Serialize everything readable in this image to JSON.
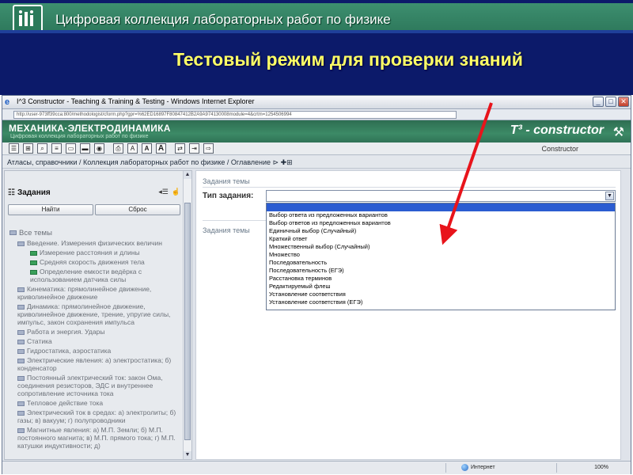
{
  "slide": {
    "header_title": "Цифровая коллекция лабораторных работ по физике",
    "title": "Тестовый режим для проверки знаний"
  },
  "browser": {
    "window_title": "I^3 Constructor - Teaching & Training & Testing - Windows Internet Explorer",
    "address": "http://user-973ff39cca:800/methodologist/cform.php?gpr=%62ED16897F80847412B2A9A974130008module=4&crtm=1254506994",
    "status_zone": "Интернет",
    "zoom": "100%"
  },
  "app": {
    "brand": "МЕХАНИКА·ЭЛЕКТРОДИНАМИКА",
    "brand_sub": "Цифровая коллекция лабораторных работ по физике",
    "constructor_logo": "T³ - constructor",
    "toolbar_label": "Constructor",
    "toolbar_icons": [
      "list-icon",
      "hierarchy-icon",
      "search-icon",
      "list-edit-icon",
      "window-icon",
      "window-tab-icon",
      "camera-icon",
      "print-icon",
      "font-small-icon",
      "font-medium-icon",
      "font-large-icon",
      "transfer-icon",
      "export-icon",
      "login-icon"
    ]
  },
  "breadcrumb": {
    "items": [
      "Атласы, справочники",
      "Коллекция лабораторных работ по физике",
      "Оглавление"
    ],
    "separator": " / "
  },
  "left_panel": {
    "title": "Задания",
    "find_button": "Найти",
    "reset_button": "Сброс",
    "tree": [
      {
        "level": 0,
        "type": "folder",
        "label": "Все темы"
      },
      {
        "level": 1,
        "type": "folder",
        "label": "Введение. Измерения физических величин"
      },
      {
        "level": 2,
        "type": "item",
        "label": "Измерение расстояния и длины"
      },
      {
        "level": 2,
        "type": "item",
        "label": "Средняя скорость движения тела"
      },
      {
        "level": 2,
        "type": "item",
        "label": "Определение емкости ведёрка с использованием датчика силы"
      },
      {
        "level": 1,
        "type": "folder",
        "label": "Кинематика: прямолинейное движение, криволинейное движение"
      },
      {
        "level": 1,
        "type": "folder",
        "label": "Динамика: прямолинейное движение, криволинейное движение, трение, упругие силы, импульс, закон сохранения импульса"
      },
      {
        "level": 1,
        "type": "folder",
        "label": "Работа и энергия. Удары"
      },
      {
        "level": 1,
        "type": "folder",
        "label": "Статика"
      },
      {
        "level": 1,
        "type": "folder",
        "label": "Гидростатика, аэростатика"
      },
      {
        "level": 1,
        "type": "folder",
        "label": "Электрические явления: а) электростатика; б) конденсатор"
      },
      {
        "level": 1,
        "type": "folder",
        "label": "Постоянный электрический ток: закон Ома, соединения резисторов, ЭДС и внутреннее сопротивление источника тока"
      },
      {
        "level": 1,
        "type": "folder",
        "label": "Тепловое действие тока"
      },
      {
        "level": 1,
        "type": "folder",
        "label": "Электрический ток в средах: а) электролиты; б) газы; в) вакуум; г) полупроводники"
      },
      {
        "level": 1,
        "type": "folder",
        "label": "Магнитные явления: а) М.П. Земли; б) М.П. постоянного магнита; в) М.П. прямого тока; г) М.П. катушки индуктивности; д)"
      }
    ]
  },
  "content": {
    "section_top": "Задания темы",
    "type_label": "Тип задания:",
    "section_mid": "Задания темы",
    "dropdown_options": [
      "Выбор ответа из предложенных вариантов",
      "Выбор ответов из предложенных вариантов",
      "Единичный выбор (Случайный)",
      "Краткий ответ",
      "Множественный выбор (Случайный)",
      "Множество",
      "Последовательность",
      "Последовательность (ЕГЭ)",
      "Расстановка терминов",
      "Редактируемый флеш",
      "Установление соответствия",
      "Установление соответствия (ЕГЭ)"
    ]
  },
  "colors": {
    "slide_bg": "#0c1a6a",
    "header_band": "#3d8f6f",
    "slide_title": "#ffff66",
    "app_banner": "#3c8a66",
    "selection": "#2b5cd1",
    "arrow": "#e8141b"
  }
}
